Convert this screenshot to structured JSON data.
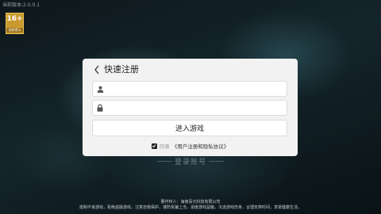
{
  "version_text": "当前版本:2.0.0.1",
  "age_badge": {
    "number": "16+",
    "label": "适龄提示"
  },
  "dialog": {
    "title": "快速注册",
    "account_field": {
      "value": "",
      "placeholder": ""
    },
    "password_field": {
      "value": "",
      "placeholder": ""
    },
    "enter_button": "进入游戏",
    "agreement": {
      "checked": true,
      "prefix": "同意",
      "link": "《用户注册和隐私协议》"
    }
  },
  "bottom_mark": "登录账号",
  "footer": {
    "line1": "著作权人：海南喜元科技有限公司",
    "line2": "抵制不良游戏，拒绝盗版游戏，注意自我保护，谨防受骗上当，适度游戏益脑，沉迷游戏伤身，合理安排时间，享受健康生活。"
  },
  "colors": {
    "badge": "#c99a2e",
    "dialog_bg": "#f2f2f2"
  }
}
